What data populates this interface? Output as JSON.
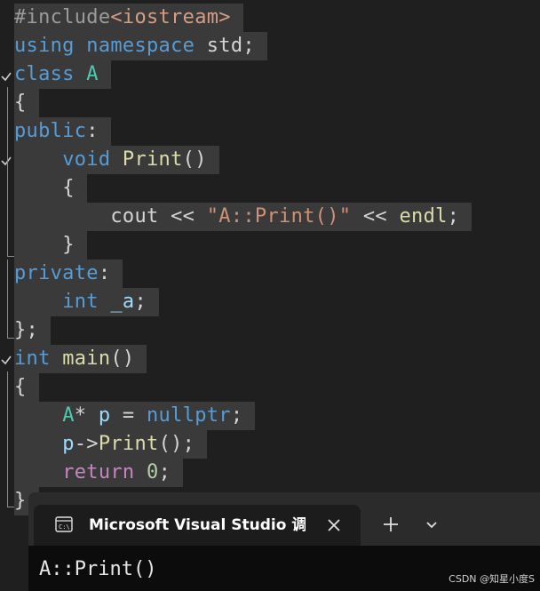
{
  "editor": {
    "lines": [
      {
        "indent": "",
        "tokens": [
          {
            "t": "#include",
            "c": "pre"
          },
          {
            "t": "<iostream>",
            "c": "inc"
          }
        ]
      },
      {
        "indent": "",
        "tokens": [
          {
            "t": "using",
            "c": "kw"
          },
          {
            "t": " ",
            "c": "punc"
          },
          {
            "t": "namespace",
            "c": "kw"
          },
          {
            "t": " std;",
            "c": "punc"
          }
        ]
      },
      {
        "indent": "",
        "tokens": [
          {
            "t": "class",
            "c": "kw"
          },
          {
            "t": " ",
            "c": "punc"
          },
          {
            "t": "A",
            "c": "type"
          }
        ]
      },
      {
        "indent": "",
        "tokens": [
          {
            "t": "{",
            "c": "punc"
          }
        ]
      },
      {
        "indent": "",
        "tokens": [
          {
            "t": "public",
            "c": "kw"
          },
          {
            "t": ":",
            "c": "punc"
          }
        ]
      },
      {
        "indent": "    ",
        "tokens": [
          {
            "t": "void",
            "c": "kw"
          },
          {
            "t": " ",
            "c": "punc"
          },
          {
            "t": "Print",
            "c": "fn"
          },
          {
            "t": "()",
            "c": "punc"
          }
        ]
      },
      {
        "indent": "    ",
        "tokens": [
          {
            "t": "{",
            "c": "punc"
          }
        ]
      },
      {
        "indent": "        ",
        "tokens": [
          {
            "t": "cout",
            "c": "punc"
          },
          {
            "t": " << ",
            "c": "punc"
          },
          {
            "t": "\"A::Print()\"",
            "c": "str"
          },
          {
            "t": " << ",
            "c": "punc"
          },
          {
            "t": "endl",
            "c": "fn"
          },
          {
            "t": ";",
            "c": "punc"
          }
        ]
      },
      {
        "indent": "    ",
        "tokens": [
          {
            "t": "}",
            "c": "punc"
          }
        ]
      },
      {
        "indent": "",
        "tokens": [
          {
            "t": "private",
            "c": "kw"
          },
          {
            "t": ":",
            "c": "punc"
          }
        ]
      },
      {
        "indent": "    ",
        "tokens": [
          {
            "t": "int",
            "c": "kw"
          },
          {
            "t": " ",
            "c": "punc"
          },
          {
            "t": "_a",
            "c": "var"
          },
          {
            "t": ";",
            "c": "punc"
          }
        ]
      },
      {
        "indent": "",
        "tokens": [
          {
            "t": "};",
            "c": "punc"
          }
        ]
      },
      {
        "indent": "",
        "tokens": [
          {
            "t": "int",
            "c": "kw"
          },
          {
            "t": " ",
            "c": "punc"
          },
          {
            "t": "main",
            "c": "fn"
          },
          {
            "t": "()",
            "c": "punc"
          }
        ]
      },
      {
        "indent": "",
        "tokens": [
          {
            "t": "{",
            "c": "punc"
          }
        ]
      },
      {
        "indent": "    ",
        "tokens": [
          {
            "t": "A",
            "c": "type"
          },
          {
            "t": "* ",
            "c": "punc"
          },
          {
            "t": "p",
            "c": "var"
          },
          {
            "t": " = ",
            "c": "punc"
          },
          {
            "t": "nullptr",
            "c": "kw"
          },
          {
            "t": ";",
            "c": "punc"
          }
        ]
      },
      {
        "indent": "    ",
        "tokens": [
          {
            "t": "p",
            "c": "var"
          },
          {
            "t": "->",
            "c": "punc"
          },
          {
            "t": "Print",
            "c": "fn"
          },
          {
            "t": "();",
            "c": "punc"
          }
        ]
      },
      {
        "indent": "    ",
        "tokens": [
          {
            "t": "return",
            "c": "ctrl"
          },
          {
            "t": " ",
            "c": "punc"
          },
          {
            "t": "0",
            "c": "num"
          },
          {
            "t": ";",
            "c": "punc"
          }
        ]
      },
      {
        "indent": "",
        "tokens": [
          {
            "t": "}",
            "c": "punc"
          }
        ]
      }
    ]
  },
  "console": {
    "tab_icon": "console-app-icon",
    "tab_title": "Microsoft Visual Studio 调试控",
    "close_icon": "close-icon",
    "new_tab_icon": "plus-icon",
    "dropdown_icon": "chevron-down-icon",
    "output": "A::Print()"
  },
  "watermark": "CSDN @知星小度S",
  "colors": {
    "editor_bg": "#1f1f1f",
    "line_highlight": "#3a3a3a",
    "keyword": "#569cd6",
    "type": "#4ec9b0",
    "function": "#dcdcaa",
    "string": "#ce9178",
    "number": "#b5cea8",
    "control": "#c586c0",
    "console_bg": "#0c0c0c",
    "titlebar_bg": "#2b2b2b"
  }
}
